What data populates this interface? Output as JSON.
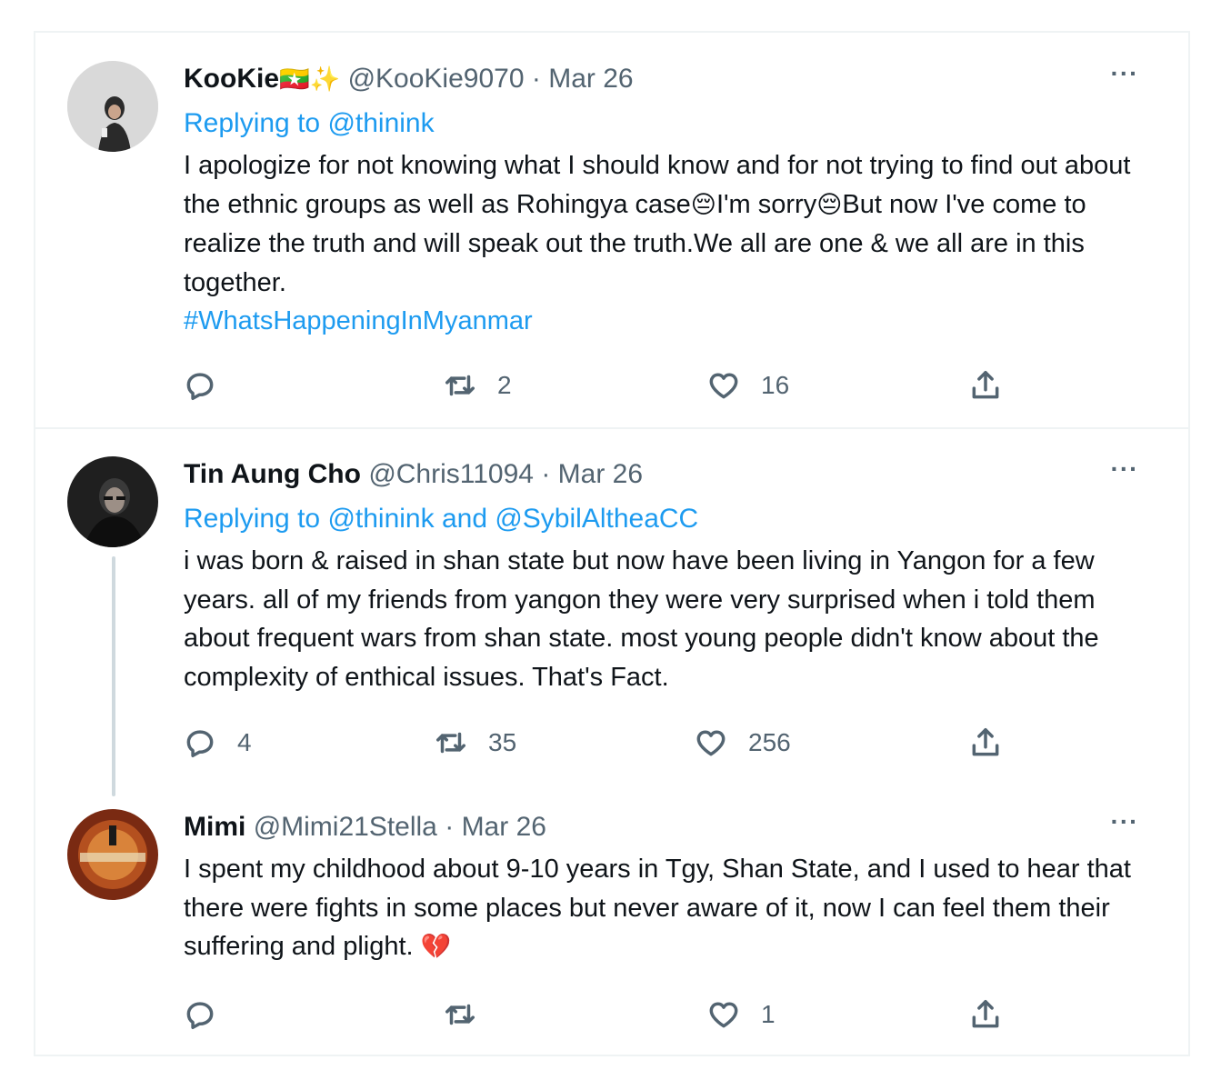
{
  "tweets": [
    {
      "name": "KooKie",
      "name_emojis": "🇲🇲✨",
      "handle": "@KooKie9070",
      "separator": "·",
      "date": "Mar 26",
      "replying_prefix": "Replying to",
      "replying_to": "@thinink",
      "text_1": "I apologize for not knowing what I should know and for not trying to find out about the ethnic groups as well as Rohingya case",
      "emoji_1": "😔",
      "text_2": "I'm sorry",
      "emoji_2": "😔",
      "text_3": "But now I've come to realize the truth and will speak out the truth.We all are one & we all are in this together.",
      "hashtag": "#WhatsHappeningInMyanmar",
      "replies": "",
      "retweets": "2",
      "likes": "16",
      "more": "···"
    },
    {
      "name": "Tin Aung Cho",
      "handle": "@Chris11094",
      "separator": "·",
      "date": "Mar 26",
      "replying_prefix": "Replying to",
      "replying_to": "@thinink and @SybilAltheaCC",
      "text": "i was born & raised in shan state but now have been living in Yangon for a few years. all of my friends from yangon they were very surprised when i told them about frequent wars from shan state. most young people didn't know about the complexity of enthical issues. That's Fact.",
      "replies": "4",
      "retweets": "35",
      "likes": "256",
      "more": "···"
    },
    {
      "name": "Mimi",
      "handle": "@Mimi21Stella",
      "separator": "·",
      "date": "Mar 26",
      "text": "I spent my childhood about 9-10 years in Tgy, Shan State, and I used to hear that there were fights in some places but never aware of it, now I can feel them their suffering  and plight.",
      "emoji": "💔",
      "replies": "",
      "retweets": "",
      "likes": "1",
      "more": "···"
    }
  ],
  "icons": {
    "reply": "reply-icon",
    "retweet": "retweet-icon",
    "like": "heart-icon",
    "share": "share-icon",
    "more": "more-icon"
  },
  "colors": {
    "link": "#1d9bf0",
    "muted": "#536471",
    "text": "#0f1419",
    "border": "#eff3f4"
  }
}
